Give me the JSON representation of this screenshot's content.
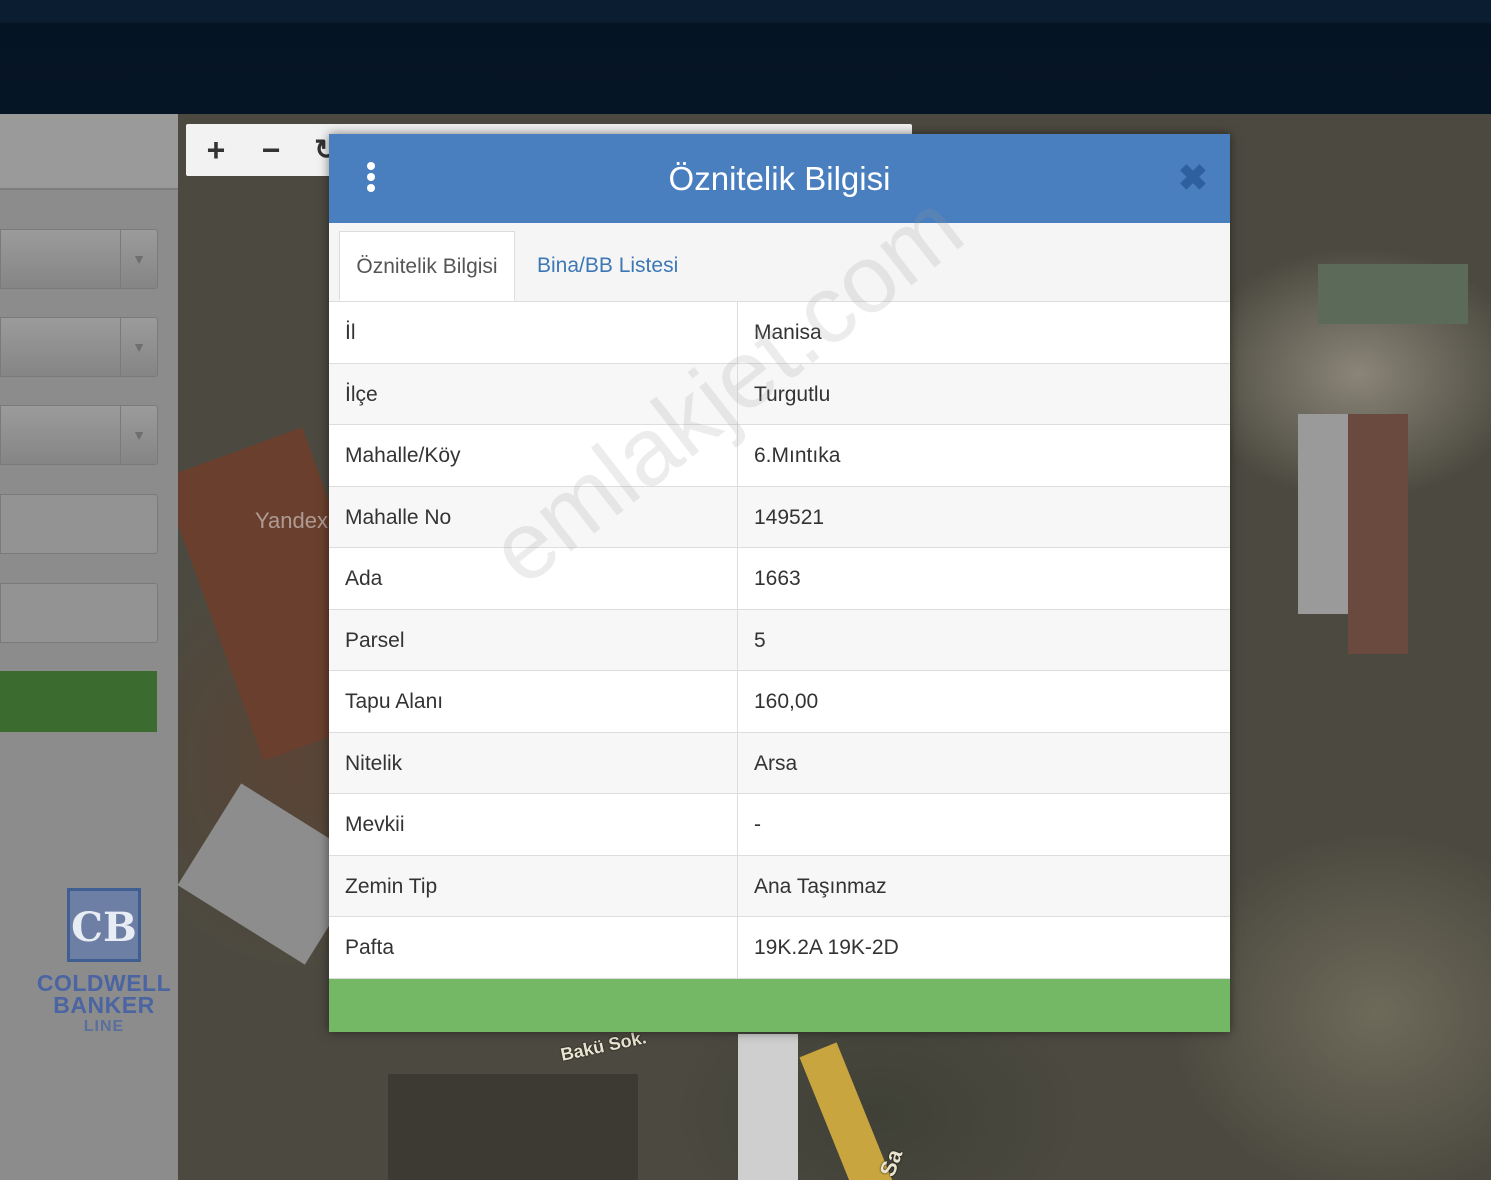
{
  "map": {
    "controls": {
      "zoom_in": "+",
      "zoom_out": "−",
      "refresh": "↻"
    },
    "provider": "Yandex",
    "street_label": "Bakü Sok.",
    "street_label2": "Sa"
  },
  "sidebar": {
    "dropdown_caret": "▼"
  },
  "brand": {
    "mark": "CB",
    "line1": "COLDWELL",
    "line2": "BANKER",
    "line3": "LINE"
  },
  "modal": {
    "title": "Öznitelik Bilgisi",
    "close": "✖",
    "tabs": [
      "Öznitelik Bilgisi",
      "Bina/BB Listesi"
    ],
    "rows": [
      {
        "key": "İl",
        "value": "Manisa"
      },
      {
        "key": "İlçe",
        "value": "Turgutlu"
      },
      {
        "key": "Mahalle/Köy",
        "value": "6.Mıntıka"
      },
      {
        "key": "Mahalle No",
        "value": "149521"
      },
      {
        "key": "Ada",
        "value": "1663"
      },
      {
        "key": "Parsel",
        "value": "5"
      },
      {
        "key": "Tapu Alanı",
        "value": "160,00"
      },
      {
        "key": "Nitelik",
        "value": "Arsa"
      },
      {
        "key": "Mevkii",
        "value": "-"
      },
      {
        "key": "Zemin Tip",
        "value": "Ana Taşınmaz"
      },
      {
        "key": "Pafta",
        "value": "19K.2A 19K-2D"
      }
    ]
  },
  "watermark": "emlakjet.com",
  "colors": {
    "modal_header": "#4a7fbf",
    "modal_footer": "#74b866",
    "tab_active_text": "#555555",
    "tab_link": "#3d77b6"
  }
}
